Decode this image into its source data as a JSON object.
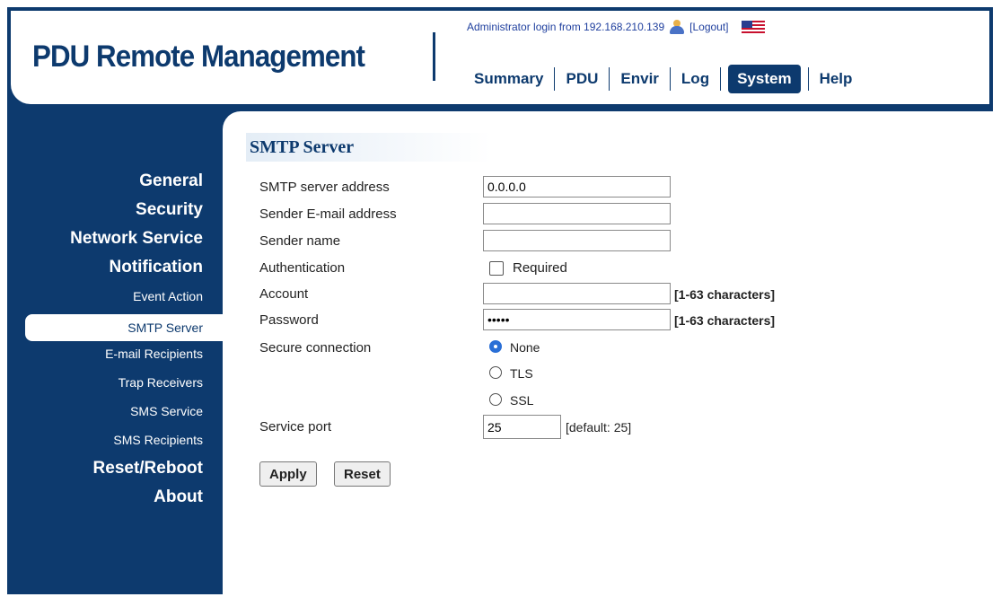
{
  "app": {
    "title": "PDU Remote Management"
  },
  "header": {
    "login_text": "Administrator login from 192.168.210.139",
    "logout_label": "[Logout]",
    "user_icon": "user-icon",
    "flag_icon": "us-flag-icon"
  },
  "nav": {
    "items": [
      {
        "label": "Summary"
      },
      {
        "label": "PDU"
      },
      {
        "label": "Envir"
      },
      {
        "label": "Log"
      },
      {
        "label": "System"
      },
      {
        "label": "Help"
      }
    ],
    "active": "System"
  },
  "sidebar": {
    "items": [
      {
        "label": "General"
      },
      {
        "label": "Security"
      },
      {
        "label": "Network Service"
      },
      {
        "label": "Notification"
      },
      {
        "label": "Event Action"
      },
      {
        "label": "SMTP Server"
      },
      {
        "label": "E-mail Recipients"
      },
      {
        "label": "Trap Receivers"
      },
      {
        "label": "SMS Service"
      },
      {
        "label": "SMS Recipients"
      },
      {
        "label": "Reset/Reboot"
      },
      {
        "label": "About"
      }
    ],
    "active": "SMTP Server"
  },
  "form": {
    "title": "SMTP Server",
    "server_address": {
      "label": "SMTP server address",
      "value": "0.0.0.0"
    },
    "sender_email": {
      "label": "Sender E-mail address",
      "value": ""
    },
    "sender_name": {
      "label": "Sender name",
      "value": ""
    },
    "authentication": {
      "label": "Authentication",
      "checkbox_label": "Required",
      "checked": false
    },
    "account": {
      "label": "Account",
      "value": "",
      "hint": "[1-63 characters]"
    },
    "password": {
      "label": "Password",
      "value": "•••••",
      "hint": "[1-63 characters]"
    },
    "secure_connection": {
      "label": "Secure connection",
      "options": [
        "None",
        "TLS",
        "SSL"
      ],
      "selected": "None"
    },
    "service_port": {
      "label": "Service port",
      "value": "25",
      "hint": "[default: 25]"
    },
    "apply_label": "Apply",
    "reset_label": "Reset"
  },
  "colors": {
    "brand": "#0d3a6e",
    "radio_selected": "#2a6fd6",
    "login_text": "#1f3f9e"
  }
}
